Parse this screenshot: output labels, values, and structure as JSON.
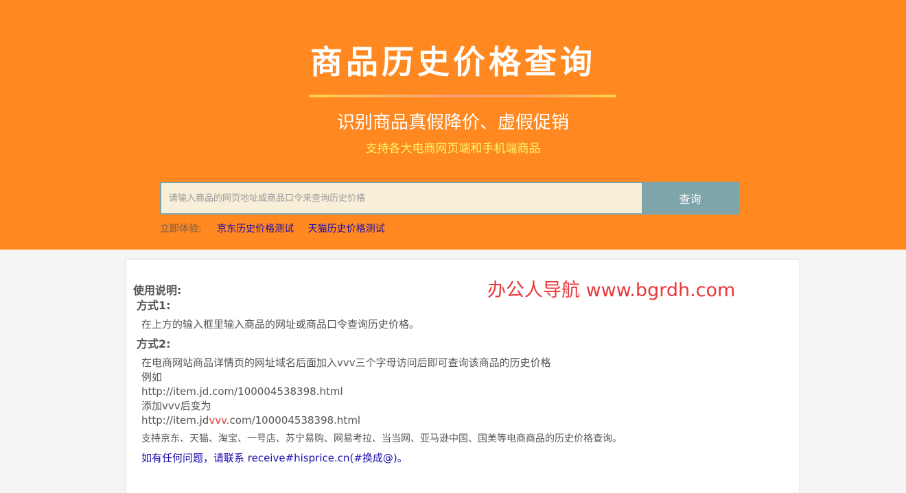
{
  "hero": {
    "title": "商品历史价格查询",
    "subtitle": "识别商品真假降价、虚假促销",
    "tagline": "支持各大电商网页端和手机端商品"
  },
  "search": {
    "placeholder": "请输入商品的网页地址或商品口令来查询历史价格",
    "value": "",
    "button_label": "查询"
  },
  "try_row": {
    "label": "立即体验:",
    "links": [
      "京东历史价格测试",
      "天猫历史价格测试"
    ]
  },
  "watermark": "办公人导航 www.bgrdh.com",
  "instructions": {
    "title": "使用说明:",
    "method1": {
      "title": "方式1:",
      "text": "在上方的输入框里输入商品的网址或商品口令查询历史价格。"
    },
    "method2": {
      "title": "方式2:",
      "line1": "在电商网站商品详情页的网址域名后面加入vvv三个字母访问后即可查询该商品的历史价格",
      "line2": "例如",
      "url_before": "http://item.jd.com/100004538398.html",
      "line4": "添加vvv后变为",
      "url_after_prefix": "http://item.jd",
      "url_after_highlight": "vvv",
      "url_after_suffix": ".com/100004538398.html"
    },
    "support": "支持京东、天猫、淘宝、一号店、苏宁易购、网易考拉、当当网、亚马逊中国、国美等电商商品的历史价格查询。",
    "contact": "如有任何问题，请联系 receive#hisprice.cn(#换成@)。"
  },
  "colors": {
    "hero_bg": "#ff8820",
    "search_button": "#7ea6aa",
    "input_bg": "#f8efd9",
    "link": "#1a0dab",
    "highlight": "#e8383b",
    "tagline": "#fff36a"
  }
}
